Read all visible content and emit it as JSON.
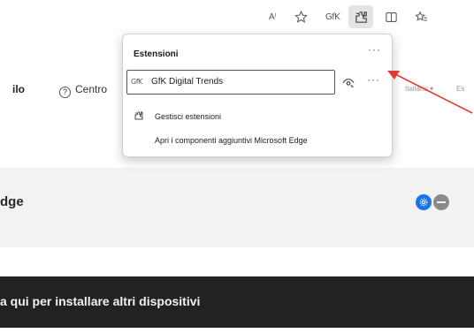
{
  "toolbar": {
    "read_aloud": "A⁾",
    "gfk_short": "GfK"
  },
  "page": {
    "nav_left": "ilo",
    "help_label": "Centro",
    "lang_label": "Italiano",
    "lang_extra": "Es",
    "section_title": "dge",
    "banner_text": "a qui per installare altri dispositivi"
  },
  "popup": {
    "title": "Estensioni",
    "more": "···",
    "extension": {
      "glyph": "GfK",
      "name": "GfK Digital Trends",
      "more": "···"
    },
    "menu": [
      {
        "label": "Gestisci estensioni",
        "icon": "extensions-icon"
      },
      {
        "label": "Apri i componenti aggiuntivi Microsoft Edge",
        "icon": ""
      }
    ]
  },
  "colors": {
    "accent": "#1a73e8",
    "annotation": "#e53935",
    "banner": "#222222"
  }
}
